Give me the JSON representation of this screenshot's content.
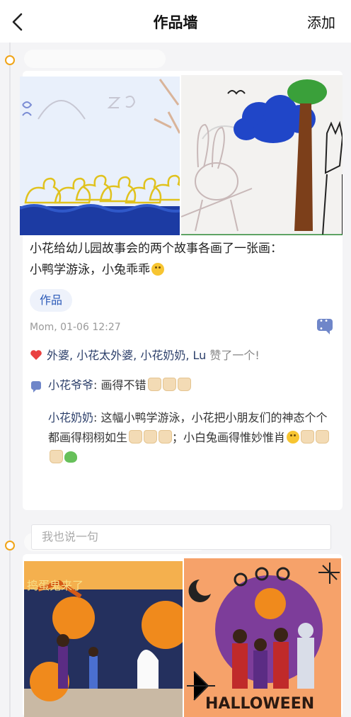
{
  "header": {
    "title": "作品墙",
    "add_label": "添加"
  },
  "post1": {
    "text_line1": "小花给幼儿园故事会的两个故事各画了一张画：",
    "text_line2": "小鸭学游泳，小兔乖乖",
    "tag": "作品",
    "time": "Mom, 01-06 12:27",
    "likes_names": "外婆, 小花太外婆, 小花奶奶, Lu",
    "likes_suffix": " 赞了一个!",
    "comments": [
      {
        "author": "小花爷爷",
        "text": ": 画得不错"
      },
      {
        "author": "小花奶奶",
        "text": ": 这幅小鸭学游泳，小花把小朋友们的神态个个都画得栩栩如生",
        "text2": "；小白兔画得惟妙惟肖"
      }
    ],
    "reply_placeholder": "我也说一句"
  },
  "post2": {
    "photo_text_1": "捣蛋鬼来了",
    "photo_text_2": "HAPPY HALLOWEEN"
  },
  "icons": {
    "back": "chevron-left-icon",
    "heart": "heart-icon",
    "comment": "comment-icon"
  },
  "colors": {
    "accent": "#f0a417",
    "link": "#2c3f6a",
    "tag_bg": "#eef2fb",
    "heart": "#e94040"
  }
}
